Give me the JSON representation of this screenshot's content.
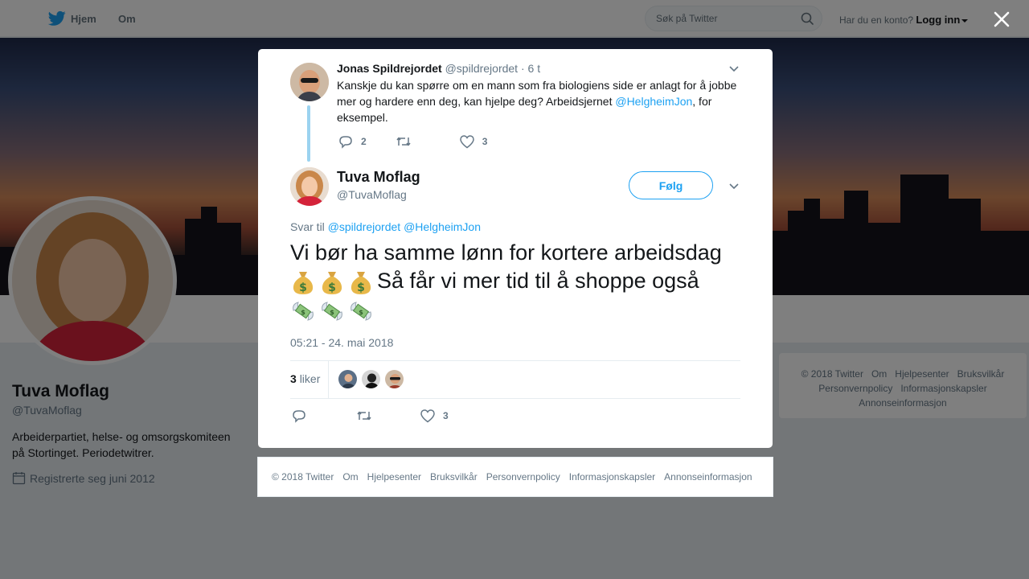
{
  "topbar": {
    "home_label": "Hjem",
    "about_label": "Om",
    "search_placeholder": "Søk på Twitter",
    "account_question": "Har du en konto?",
    "login_label": "Logg inn"
  },
  "profile": {
    "name": "Tuva Moflag",
    "handle": "@TuvaMoflag",
    "bio": "Arbeiderpartiet, helse- og omsorgskomiteen på Stortinget. Periodetwitrer.",
    "joined": "Registrerte seg juni 2012"
  },
  "side_footer": {
    "links": [
      "© 2018 Twitter",
      "Om",
      "Hjelpesenter",
      "Bruksvilkår",
      "Personvernpolicy",
      "Informasjonskapsler",
      "Annonseinformasjon"
    ]
  },
  "parent_tweet": {
    "author_name": "Jonas Spildrejordet",
    "author_handle": "@spildrejordet",
    "time": "· 6 t",
    "text_before": "Kanskje du kan spørre om en mann som fra biologiens side er anlagt for å jobbe mer og hardere enn deg, kan hjelpe deg? Arbeidsjernet ",
    "mention": "@HelgheimJon",
    "text_after": ", for eksempel.",
    "reply_count": "2",
    "like_count": "3"
  },
  "main_tweet": {
    "author_name": "Tuva Moflag",
    "author_handle": "@TuvaMoflag",
    "follow_label": "Følg",
    "reply_to_label": "Svar til",
    "reply_to_1": "@spildrejordet",
    "reply_to_2": "@HelgheimJon",
    "text_line1": "Vi bør ha samme lønn for kortere arbeidsdag",
    "text_line2": "Så får vi mer tid til å shoppe også",
    "timestamp": "05:21 - 24. mai 2018",
    "likes_count": "3",
    "likes_label": "liker",
    "action_like_count": "3"
  },
  "modal_footer": {
    "links": [
      "© 2018 Twitter",
      "Om",
      "Hjelpesenter",
      "Bruksvilkår",
      "Personvernpolicy",
      "Informasjonskapsler",
      "Annonseinformasjon"
    ]
  },
  "colors": {
    "accent": "#1da1f2",
    "thread_line": "#9bd3f0",
    "muted": "#657786"
  },
  "icons": [
    "twitter-bird-icon",
    "search-icon",
    "close-icon",
    "calendar-icon",
    "reply-icon",
    "retweet-icon",
    "heart-icon",
    "chevron-down-icon",
    "money-bag-icon",
    "money-wings-icon"
  ]
}
